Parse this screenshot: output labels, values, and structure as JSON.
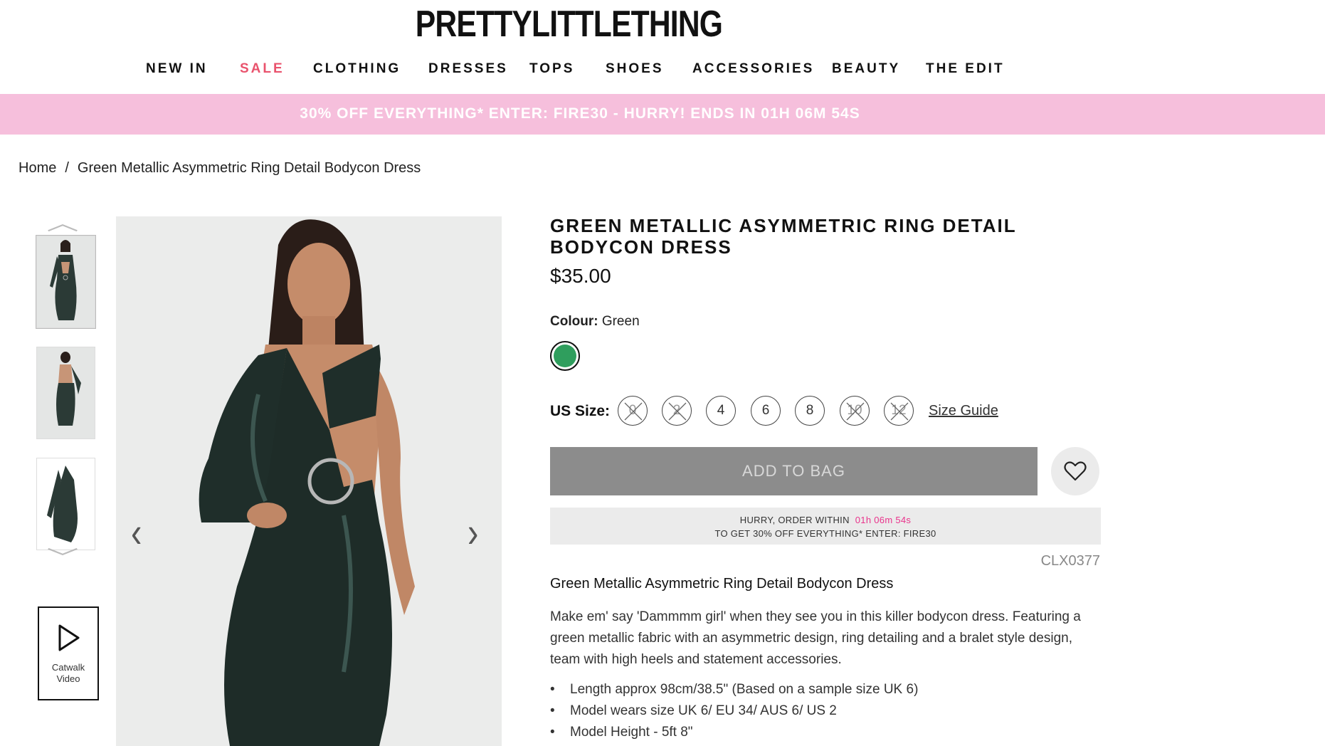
{
  "brand": {
    "logo_text": "PRETTYLITTLETHING"
  },
  "nav": {
    "items": [
      {
        "label": "NEW IN"
      },
      {
        "label": "SALE"
      },
      {
        "label": "CLOTHING"
      },
      {
        "label": "DRESSES"
      },
      {
        "label": "TOPS"
      },
      {
        "label": "SHOES"
      },
      {
        "label": "ACCESSORIES"
      },
      {
        "label": "BEAUTY"
      },
      {
        "label": "THE EDIT"
      }
    ]
  },
  "promo": {
    "text": "30% OFF EVERYTHING* ENTER: FIRE30 - HURRY! ENDS IN 01H 06M 54S"
  },
  "breadcrumb": {
    "home": "Home",
    "separator": "/",
    "current": "Green Metallic Asymmetric Ring Detail Bodycon Dress"
  },
  "gallery": {
    "video_label_1": "Catwalk",
    "video_label_2": "Video",
    "arrow_up": "︿",
    "arrow_down": "﹀",
    "prev": "‹",
    "next": "›"
  },
  "product": {
    "title": "GREEN METALLIC ASYMMETRIC RING DETAIL BODYCON DRESS",
    "price": "$35.00",
    "colour_label": "Colour:",
    "colour_value": "Green",
    "swatch_color": "#2f9e5d",
    "size_label": "US Size:",
    "sizes": [
      {
        "label": "0",
        "available": false
      },
      {
        "label": "2",
        "available": false
      },
      {
        "label": "4",
        "available": true
      },
      {
        "label": "6",
        "available": true
      },
      {
        "label": "8",
        "available": true
      },
      {
        "label": "10",
        "available": false
      },
      {
        "label": "12",
        "available": false
      }
    ],
    "size_guide": "Size Guide",
    "add_to_bag": "ADD TO BAG",
    "hurry_line1": "HURRY, ORDER WITHIN",
    "hurry_timer": "01h 06m 54s",
    "hurry_line2": "TO GET 30% OFF EVERYTHING* ENTER: FIRE30",
    "sku": "CLX0377",
    "description_title": "Green Metallic Asymmetric Ring Detail Bodycon Dress",
    "description": "Make em' say 'Dammmm girl' when they see you in this killer bodycon dress. Featuring a green metallic fabric with an asymmetric design, ring detailing and a bralet style design, team with high heels and statement accessories.",
    "bullets": [
      "Length approx 98cm/38.5\" (Based on a sample size UK 6)",
      "Model wears size UK 6/ EU 34/ AUS 6/ US 2",
      "Model Height - 5ft 8\""
    ]
  },
  "colors": {
    "promo_pink": "#f6bfdc",
    "sale_red": "#e9536d",
    "timer_pink": "#e9348c",
    "bag_button": "#8c8c8c"
  }
}
